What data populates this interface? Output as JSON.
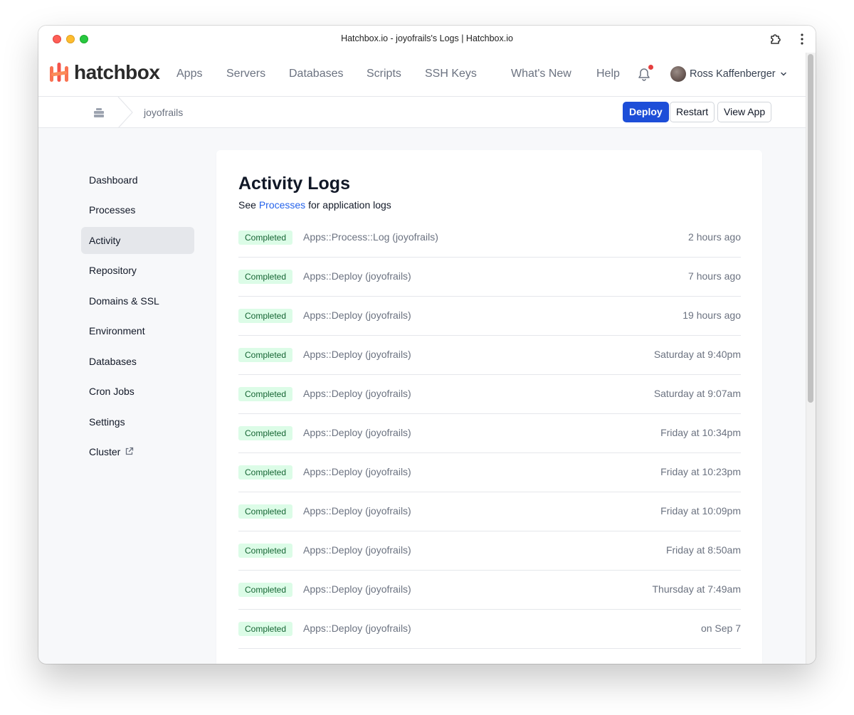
{
  "browser": {
    "window_title": "Hatchbox.io - joyofrails's Logs | Hatchbox.io"
  },
  "header": {
    "logo_text": "hatchbox",
    "nav": [
      "Apps",
      "Servers",
      "Databases",
      "Scripts",
      "SSH Keys",
      "What's New",
      "Help"
    ],
    "user_name": "Ross Kaffenberger",
    "notification_dot_color": "#e53e3e"
  },
  "breadcrumb": {
    "app_name": "joyofrails",
    "buttons": {
      "deploy": "Deploy",
      "restart": "Restart",
      "view_app": "View App"
    }
  },
  "sidebar": {
    "items": [
      {
        "label": "Dashboard"
      },
      {
        "label": "Processes"
      },
      {
        "label": "Activity"
      },
      {
        "label": "Repository"
      },
      {
        "label": "Domains & SSL"
      },
      {
        "label": "Environment"
      },
      {
        "label": "Databases"
      },
      {
        "label": "Cron Jobs"
      },
      {
        "label": "Settings"
      },
      {
        "label": "Cluster"
      }
    ],
    "active": "Activity"
  },
  "main": {
    "title": "Activity Logs",
    "subtitle_prefix": "See",
    "subtitle_link": "Processes",
    "subtitle_suffix": "for application logs",
    "logs": [
      {
        "status": "Completed",
        "name": "Apps::Process::Log (joyofrails)",
        "time": "2 hours ago"
      },
      {
        "status": "Completed",
        "name": "Apps::Deploy (joyofrails)",
        "time": "7 hours ago"
      },
      {
        "status": "Completed",
        "name": "Apps::Deploy (joyofrails)",
        "time": "19 hours ago"
      },
      {
        "status": "Completed",
        "name": "Apps::Deploy (joyofrails)",
        "time": "Saturday at 9:40pm"
      },
      {
        "status": "Completed",
        "name": "Apps::Deploy (joyofrails)",
        "time": "Saturday at 9:07am"
      },
      {
        "status": "Completed",
        "name": "Apps::Deploy (joyofrails)",
        "time": "Friday at 10:34pm"
      },
      {
        "status": "Completed",
        "name": "Apps::Deploy (joyofrails)",
        "time": "Friday at 10:23pm"
      },
      {
        "status": "Completed",
        "name": "Apps::Deploy (joyofrails)",
        "time": "Friday at 10:09pm"
      },
      {
        "status": "Completed",
        "name": "Apps::Deploy (joyofrails)",
        "time": "Friday at 8:50am"
      },
      {
        "status": "Completed",
        "name": "Apps::Deploy (joyofrails)",
        "time": "Thursday at 7:49am"
      },
      {
        "status": "Completed",
        "name": "Apps::Deploy (joyofrails)",
        "time": "on Sep 7"
      }
    ]
  },
  "colors": {
    "accent": "#1d4ed8",
    "link": "#2563eb",
    "badge_bg": "#dcfce7",
    "badge_text": "#166534",
    "logo_orange": "#f97352"
  }
}
